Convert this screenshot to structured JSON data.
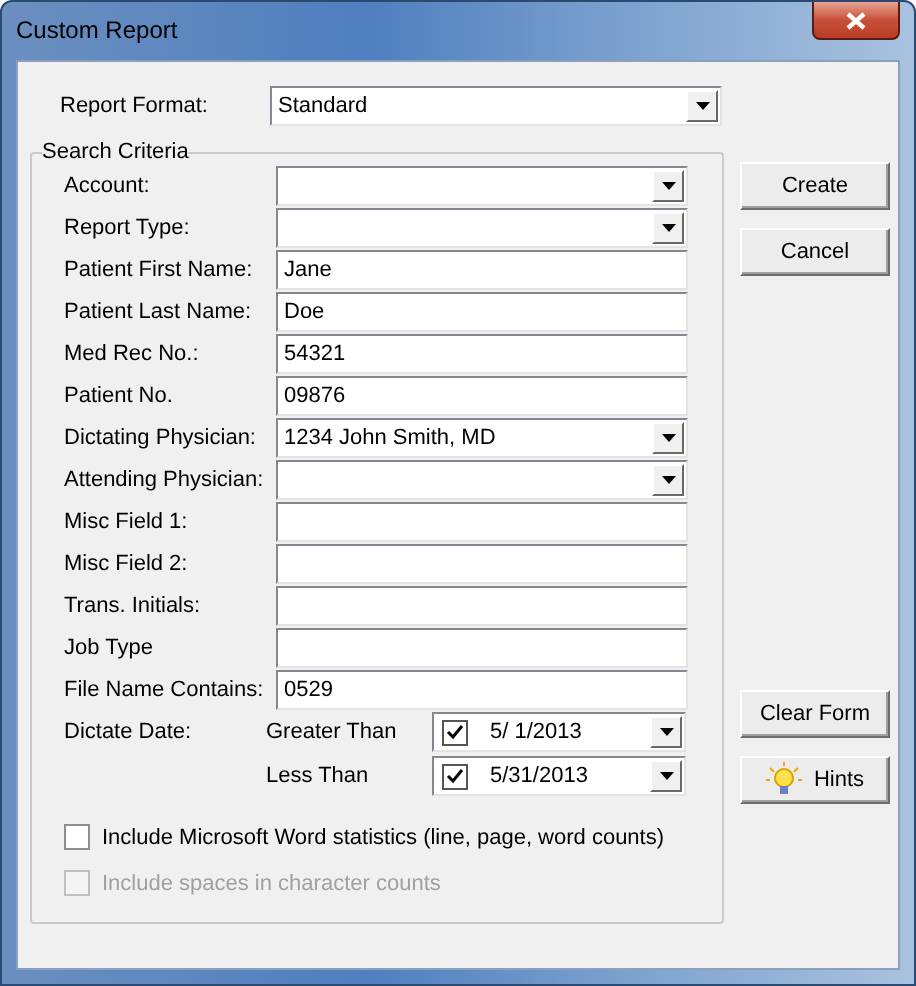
{
  "window": {
    "title": "Custom Report"
  },
  "report_format": {
    "label": "Report Format:",
    "value": "Standard"
  },
  "search_criteria": {
    "title": "Search Criteria",
    "fields": [
      {
        "kind": "dropdown",
        "label": "Account:"
      },
      {
        "kind": "dropdown",
        "label": "Report Type:"
      },
      {
        "kind": "text",
        "label": "Patient First Name:",
        "value": "Jane"
      },
      {
        "kind": "text",
        "label": "Patient Last Name:",
        "value": "Doe"
      },
      {
        "kind": "text",
        "label": "Med Rec No.:",
        "value": "54321"
      },
      {
        "kind": "text",
        "label": "Patient No.",
        "value": "09876"
      },
      {
        "kind": "dropdown",
        "label": "Dictating Physician:",
        "value": "1234 John Smith, MD"
      },
      {
        "kind": "dropdown",
        "label": "Attending Physician:"
      },
      {
        "kind": "text",
        "label": "Misc Field 1:"
      },
      {
        "kind": "text",
        "label": "Misc Field 2:"
      },
      {
        "kind": "text",
        "label": "Trans. Initials:"
      },
      {
        "kind": "text",
        "label": "Job Type"
      },
      {
        "kind": "text",
        "label": "File Name Contains:",
        "value": "0529"
      }
    ],
    "dictate_date": {
      "label": "Dictate Date:",
      "ranges": [
        {
          "label": "Greater Than",
          "checked": true,
          "value": "5/  1/2013"
        },
        {
          "label": "Less Than",
          "checked": true,
          "value": "5/31/2013"
        }
      ]
    },
    "options": [
      {
        "label": "Include Microsoft Word statistics (line, page, word counts)",
        "checked": false,
        "disabled": false
      },
      {
        "label": "Include spaces in character counts",
        "checked": false,
        "disabled": true
      }
    ]
  },
  "buttons": {
    "top": [
      "Create",
      "Cancel"
    ],
    "bottom": [
      {
        "kind": "plain",
        "label": "Clear Form"
      },
      {
        "kind": "hint",
        "label": "Hints"
      }
    ]
  }
}
